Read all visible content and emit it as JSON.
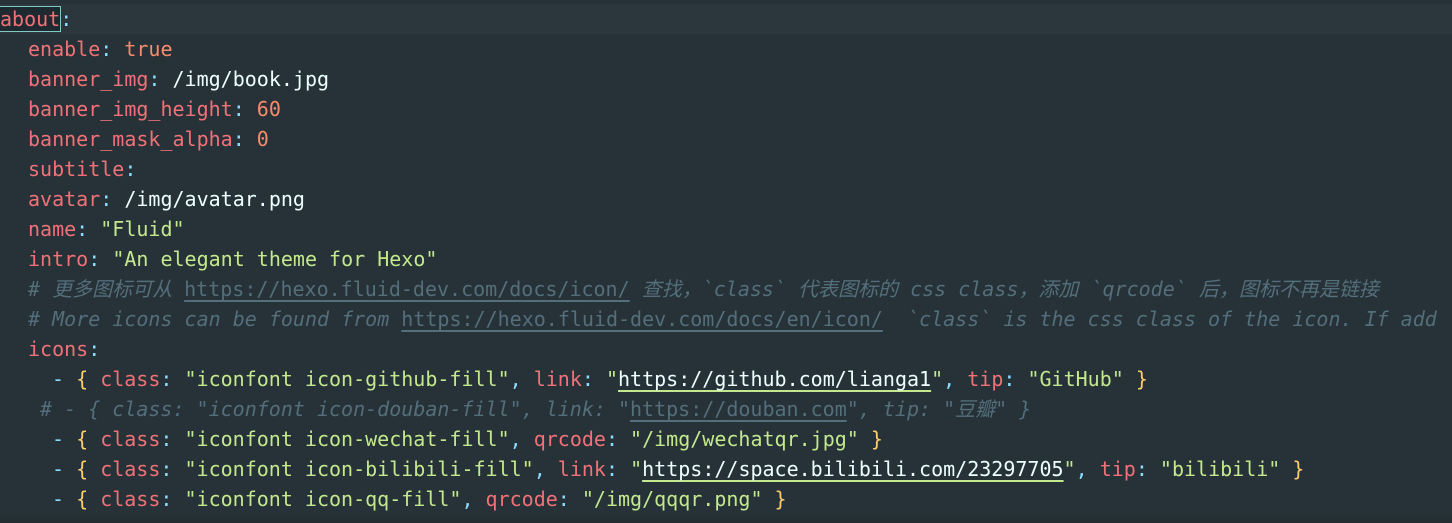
{
  "editor": {
    "language": "yaml",
    "lines": [
      [
        {
          "t": "key-cursor",
          "v": "about"
        },
        {
          "t": "punc",
          "v": ":"
        }
      ],
      [
        {
          "t": "ind1"
        },
        {
          "t": "key",
          "v": "enable"
        },
        {
          "t": "punc",
          "v": ": "
        },
        {
          "t": "bool",
          "v": "true"
        }
      ],
      [
        {
          "t": "ind1"
        },
        {
          "t": "key",
          "v": "banner_img"
        },
        {
          "t": "punc",
          "v": ": "
        },
        {
          "t": "val",
          "v": "/img/book.jpg"
        }
      ],
      [
        {
          "t": "ind1"
        },
        {
          "t": "key",
          "v": "banner_img_height"
        },
        {
          "t": "punc",
          "v": ": "
        },
        {
          "t": "num",
          "v": "60"
        }
      ],
      [
        {
          "t": "ind1"
        },
        {
          "t": "key",
          "v": "banner_mask_alpha"
        },
        {
          "t": "punc",
          "v": ": "
        },
        {
          "t": "num",
          "v": "0"
        }
      ],
      [
        {
          "t": "ind1"
        },
        {
          "t": "key",
          "v": "subtitle"
        },
        {
          "t": "punc",
          "v": ":"
        }
      ],
      [
        {
          "t": "ind1"
        },
        {
          "t": "key",
          "v": "avatar"
        },
        {
          "t": "punc",
          "v": ": "
        },
        {
          "t": "val",
          "v": "/img/avatar.png"
        }
      ],
      [
        {
          "t": "ind1"
        },
        {
          "t": "key",
          "v": "name"
        },
        {
          "t": "punc",
          "v": ": "
        },
        {
          "t": "str",
          "v": "\"Fluid\""
        }
      ],
      [
        {
          "t": "ind1"
        },
        {
          "t": "key",
          "v": "intro"
        },
        {
          "t": "punc",
          "v": ": "
        },
        {
          "t": "str",
          "v": "\"An elegant theme for Hexo\""
        }
      ],
      [
        {
          "t": "ind1"
        },
        {
          "t": "com",
          "v": "# 更多图标可从 "
        },
        {
          "t": "comlink",
          "v": "https://hexo.fluid-dev.com/docs/icon/"
        },
        {
          "t": "com",
          "v": " 查找，`class` 代表图标的 css class，添加 `qrcode` 后，图标不再是链接"
        }
      ],
      [
        {
          "t": "ind1"
        },
        {
          "t": "com",
          "v": "# More icons can be found from "
        },
        {
          "t": "comlink",
          "v": "https://hexo.fluid-dev.com/docs/en/icon/"
        },
        {
          "t": "com",
          "v": "  `class` is the css class of the icon. If add"
        }
      ],
      [
        {
          "t": "ind1"
        },
        {
          "t": "key",
          "v": "icons"
        },
        {
          "t": "punc",
          "v": ":"
        }
      ],
      [
        {
          "t": "ind2"
        },
        {
          "t": "dash",
          "v": "- "
        },
        {
          "t": "brace",
          "v": "{ "
        },
        {
          "t": "key",
          "v": "class"
        },
        {
          "t": "punc",
          "v": ": "
        },
        {
          "t": "str",
          "v": "\"iconfont icon-github-fill\""
        },
        {
          "t": "punc",
          "v": ", "
        },
        {
          "t": "key",
          "v": "link"
        },
        {
          "t": "punc",
          "v": ": "
        },
        {
          "t": "str",
          "v": "\""
        },
        {
          "t": "url",
          "v": "https://github.com/lianga1"
        },
        {
          "t": "str",
          "v": "\""
        },
        {
          "t": "punc",
          "v": ", "
        },
        {
          "t": "key",
          "v": "tip"
        },
        {
          "t": "punc",
          "v": ": "
        },
        {
          "t": "str",
          "v": "\"GitHub\""
        },
        {
          "t": "brace",
          "v": " }"
        }
      ],
      [
        {
          "t": "indc"
        },
        {
          "t": "com",
          "v": "# - { class: \"iconfont icon-douban-fill\", link: \""
        },
        {
          "t": "comlink",
          "v": "https://douban.com"
        },
        {
          "t": "com",
          "v": "\", tip: \"豆瓣\" }"
        }
      ],
      [
        {
          "t": "ind2"
        },
        {
          "t": "dash",
          "v": "- "
        },
        {
          "t": "brace",
          "v": "{ "
        },
        {
          "t": "key",
          "v": "class"
        },
        {
          "t": "punc",
          "v": ": "
        },
        {
          "t": "str",
          "v": "\"iconfont icon-wechat-fill\""
        },
        {
          "t": "punc",
          "v": ", "
        },
        {
          "t": "key",
          "v": "qrcode"
        },
        {
          "t": "punc",
          "v": ": "
        },
        {
          "t": "str",
          "v": "\"/img/wechatqr.jpg\""
        },
        {
          "t": "brace",
          "v": " }"
        }
      ],
      [
        {
          "t": "ind2"
        },
        {
          "t": "dash",
          "v": "- "
        },
        {
          "t": "brace",
          "v": "{ "
        },
        {
          "t": "key",
          "v": "class"
        },
        {
          "t": "punc",
          "v": ": "
        },
        {
          "t": "str",
          "v": "\"iconfont icon-bilibili-fill\""
        },
        {
          "t": "punc",
          "v": ", "
        },
        {
          "t": "key",
          "v": "link"
        },
        {
          "t": "punc",
          "v": ": "
        },
        {
          "t": "str",
          "v": "\""
        },
        {
          "t": "url",
          "v": "https://space.bilibili.com/23297705"
        },
        {
          "t": "str",
          "v": "\""
        },
        {
          "t": "punc",
          "v": ", "
        },
        {
          "t": "key",
          "v": "tip"
        },
        {
          "t": "punc",
          "v": ": "
        },
        {
          "t": "str",
          "v": "\"bilibili\""
        },
        {
          "t": "brace",
          "v": " }"
        }
      ],
      [
        {
          "t": "ind2"
        },
        {
          "t": "dash",
          "v": "- "
        },
        {
          "t": "brace",
          "v": "{ "
        },
        {
          "t": "key",
          "v": "class"
        },
        {
          "t": "punc",
          "v": ": "
        },
        {
          "t": "str",
          "v": "\"iconfont icon-qq-fill\""
        },
        {
          "t": "punc",
          "v": ", "
        },
        {
          "t": "key",
          "v": "qrcode"
        },
        {
          "t": "punc",
          "v": ": "
        },
        {
          "t": "str",
          "v": "\"/img/qqqr.png\""
        },
        {
          "t": "brace",
          "v": " }"
        }
      ]
    ]
  },
  "colors": {
    "background": "#263238",
    "key": "#f07178",
    "string": "#c3e88d",
    "number": "#f78c6c",
    "brace": "#ffcb6b",
    "punctuation": "#89ddff",
    "comment": "#546e7a",
    "cursor_outline": "#80cbc4"
  }
}
